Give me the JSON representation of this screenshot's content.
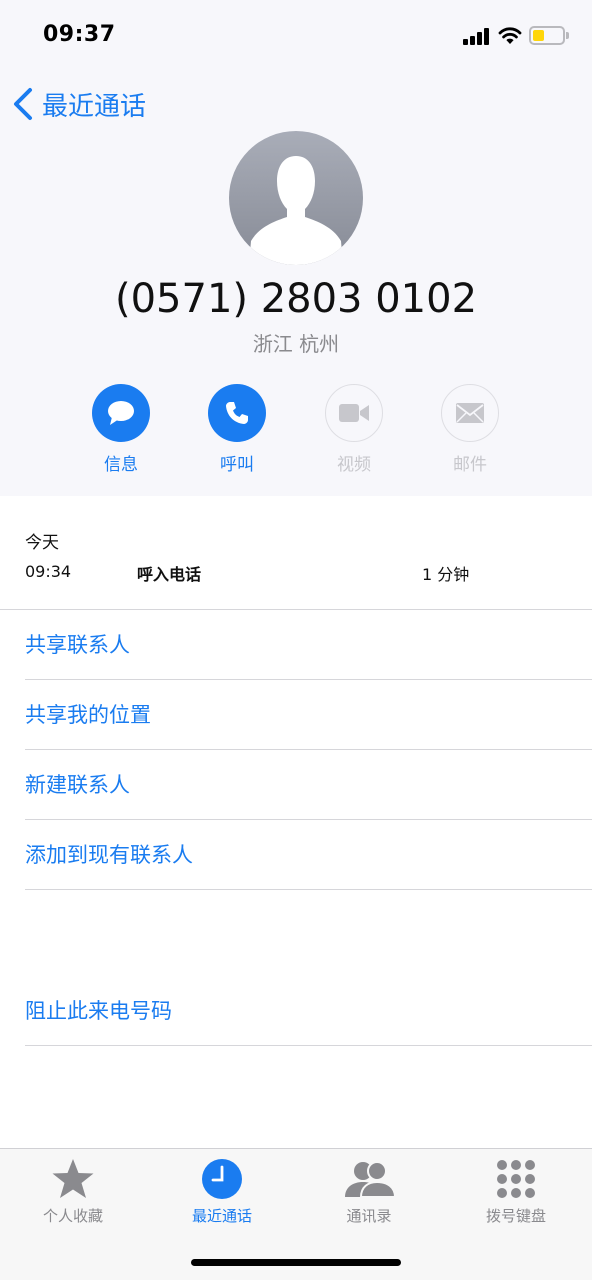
{
  "status_bar": {
    "time": "09:37"
  },
  "nav": {
    "back_label": "最近通话"
  },
  "contact": {
    "phone_number": "(0571) 2803 0102",
    "location": "浙江 杭州"
  },
  "actions": [
    {
      "label": "信息",
      "icon": "message-icon",
      "enabled": true
    },
    {
      "label": "呼叫",
      "icon": "phone-icon",
      "enabled": true
    },
    {
      "label": "视频",
      "icon": "video-icon",
      "enabled": false
    },
    {
      "label": "邮件",
      "icon": "mail-icon",
      "enabled": false
    }
  ],
  "call_log": {
    "date_header": "今天",
    "entries": [
      {
        "time": "09:34",
        "type": "呼入电话",
        "duration": "1 分钟"
      }
    ]
  },
  "menu": {
    "share_contact": "共享联系人",
    "share_location": "共享我的位置",
    "new_contact": "新建联系人",
    "add_to_existing": "添加到现有联系人",
    "block_caller": "阻止此来电号码"
  },
  "tab_bar": {
    "tabs": [
      {
        "label": "个人收藏",
        "icon": "star-icon",
        "active": false
      },
      {
        "label": "最近通话",
        "icon": "clock-icon",
        "active": true
      },
      {
        "label": "通讯录",
        "icon": "contacts-icon",
        "active": false
      },
      {
        "label": "拨号键盘",
        "icon": "keypad-icon",
        "active": false
      }
    ]
  },
  "colors": {
    "accent": "#1a7cf0",
    "header_background": "#f7f7fb",
    "secondary_text": "#8a8a8e",
    "disabled": "#c7c7cc"
  }
}
